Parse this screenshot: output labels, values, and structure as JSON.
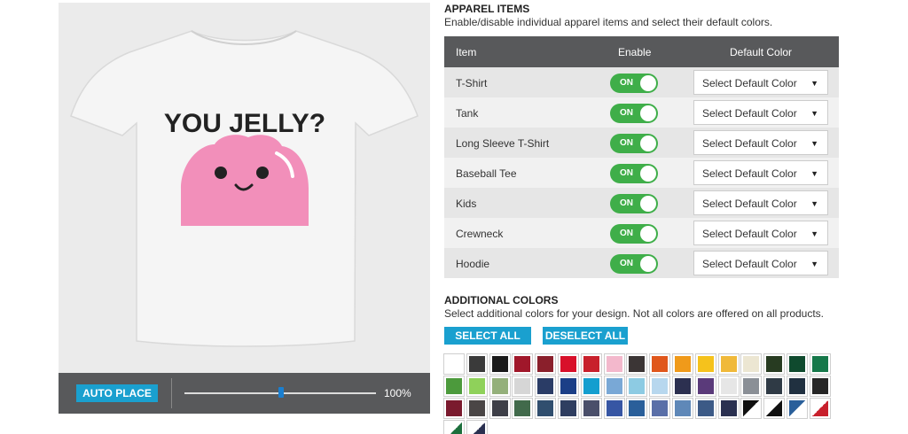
{
  "preview": {
    "design_text": "YOU JELLY?",
    "auto_place_label": "AUTO PLACE",
    "zoom_label": "100%",
    "zoom_fraction": 0.5
  },
  "apparel": {
    "title": "APPAREL ITEMS",
    "subtitle": "Enable/disable individual apparel items and select their default colors.",
    "col_item": "Item",
    "col_enable": "Enable",
    "col_color": "Default Color",
    "rows": [
      {
        "label": "T-Shirt",
        "toggle": "ON",
        "color": "Select Default Color"
      },
      {
        "label": "Tank",
        "toggle": "ON",
        "color": "Select Default Color"
      },
      {
        "label": "Long Sleeve T-Shirt",
        "toggle": "ON",
        "color": "Select Default Color"
      },
      {
        "label": "Baseball Tee",
        "toggle": "ON",
        "color": "Select Default Color"
      },
      {
        "label": "Kids",
        "toggle": "ON",
        "color": "Select Default Color"
      },
      {
        "label": "Crewneck",
        "toggle": "ON",
        "color": "Select Default Color"
      },
      {
        "label": "Hoodie",
        "toggle": "ON",
        "color": "Select Default Color"
      }
    ]
  },
  "additional": {
    "title": "ADDITIONAL COLORS",
    "subtitle": "Select additional colors for your design. Not all colors are offered on all products.",
    "select_all": "SELECT ALL",
    "deselect_all": "DESELECT ALL",
    "swatches": [
      "#ffffff",
      "#3a3a3a",
      "#1a1a1a",
      "#a0172a",
      "#8a1f2b",
      "#d8102a",
      "#c8202c",
      "#f3b8cc",
      "#3b3535",
      "#e0571c",
      "#f09a1a",
      "#f5c21c",
      "#f0b93a",
      "#ece6d2",
      "#273b21",
      "#0f4a2e",
      "#16784a",
      "#4c9a3c",
      "#8fd15a",
      "#94b07a",
      "#d6d6d6",
      "#2a3c66",
      "#1b3f87",
      "#139ecf",
      "#79a8d6",
      "#8dcbe3",
      "#b7d7ee",
      "#2c3050",
      "#5a3a7a",
      "#e6e6e6",
      "#8a8f96",
      "#2f3a45",
      "#203040",
      "#262626",
      "#7a1a2e",
      "#4a4646",
      "#3e3f48",
      "#416a4b",
      "#304e6e",
      "#2f3e60",
      "#4a4f6a",
      "#3756a4",
      "#2a5f9a",
      "#5a6fa8",
      "#5f88b8",
      "#3c5a86",
      "#2a3050",
      "#split1",
      "#split2",
      "#split3",
      "#split4",
      "#split5",
      "#split6"
    ]
  }
}
